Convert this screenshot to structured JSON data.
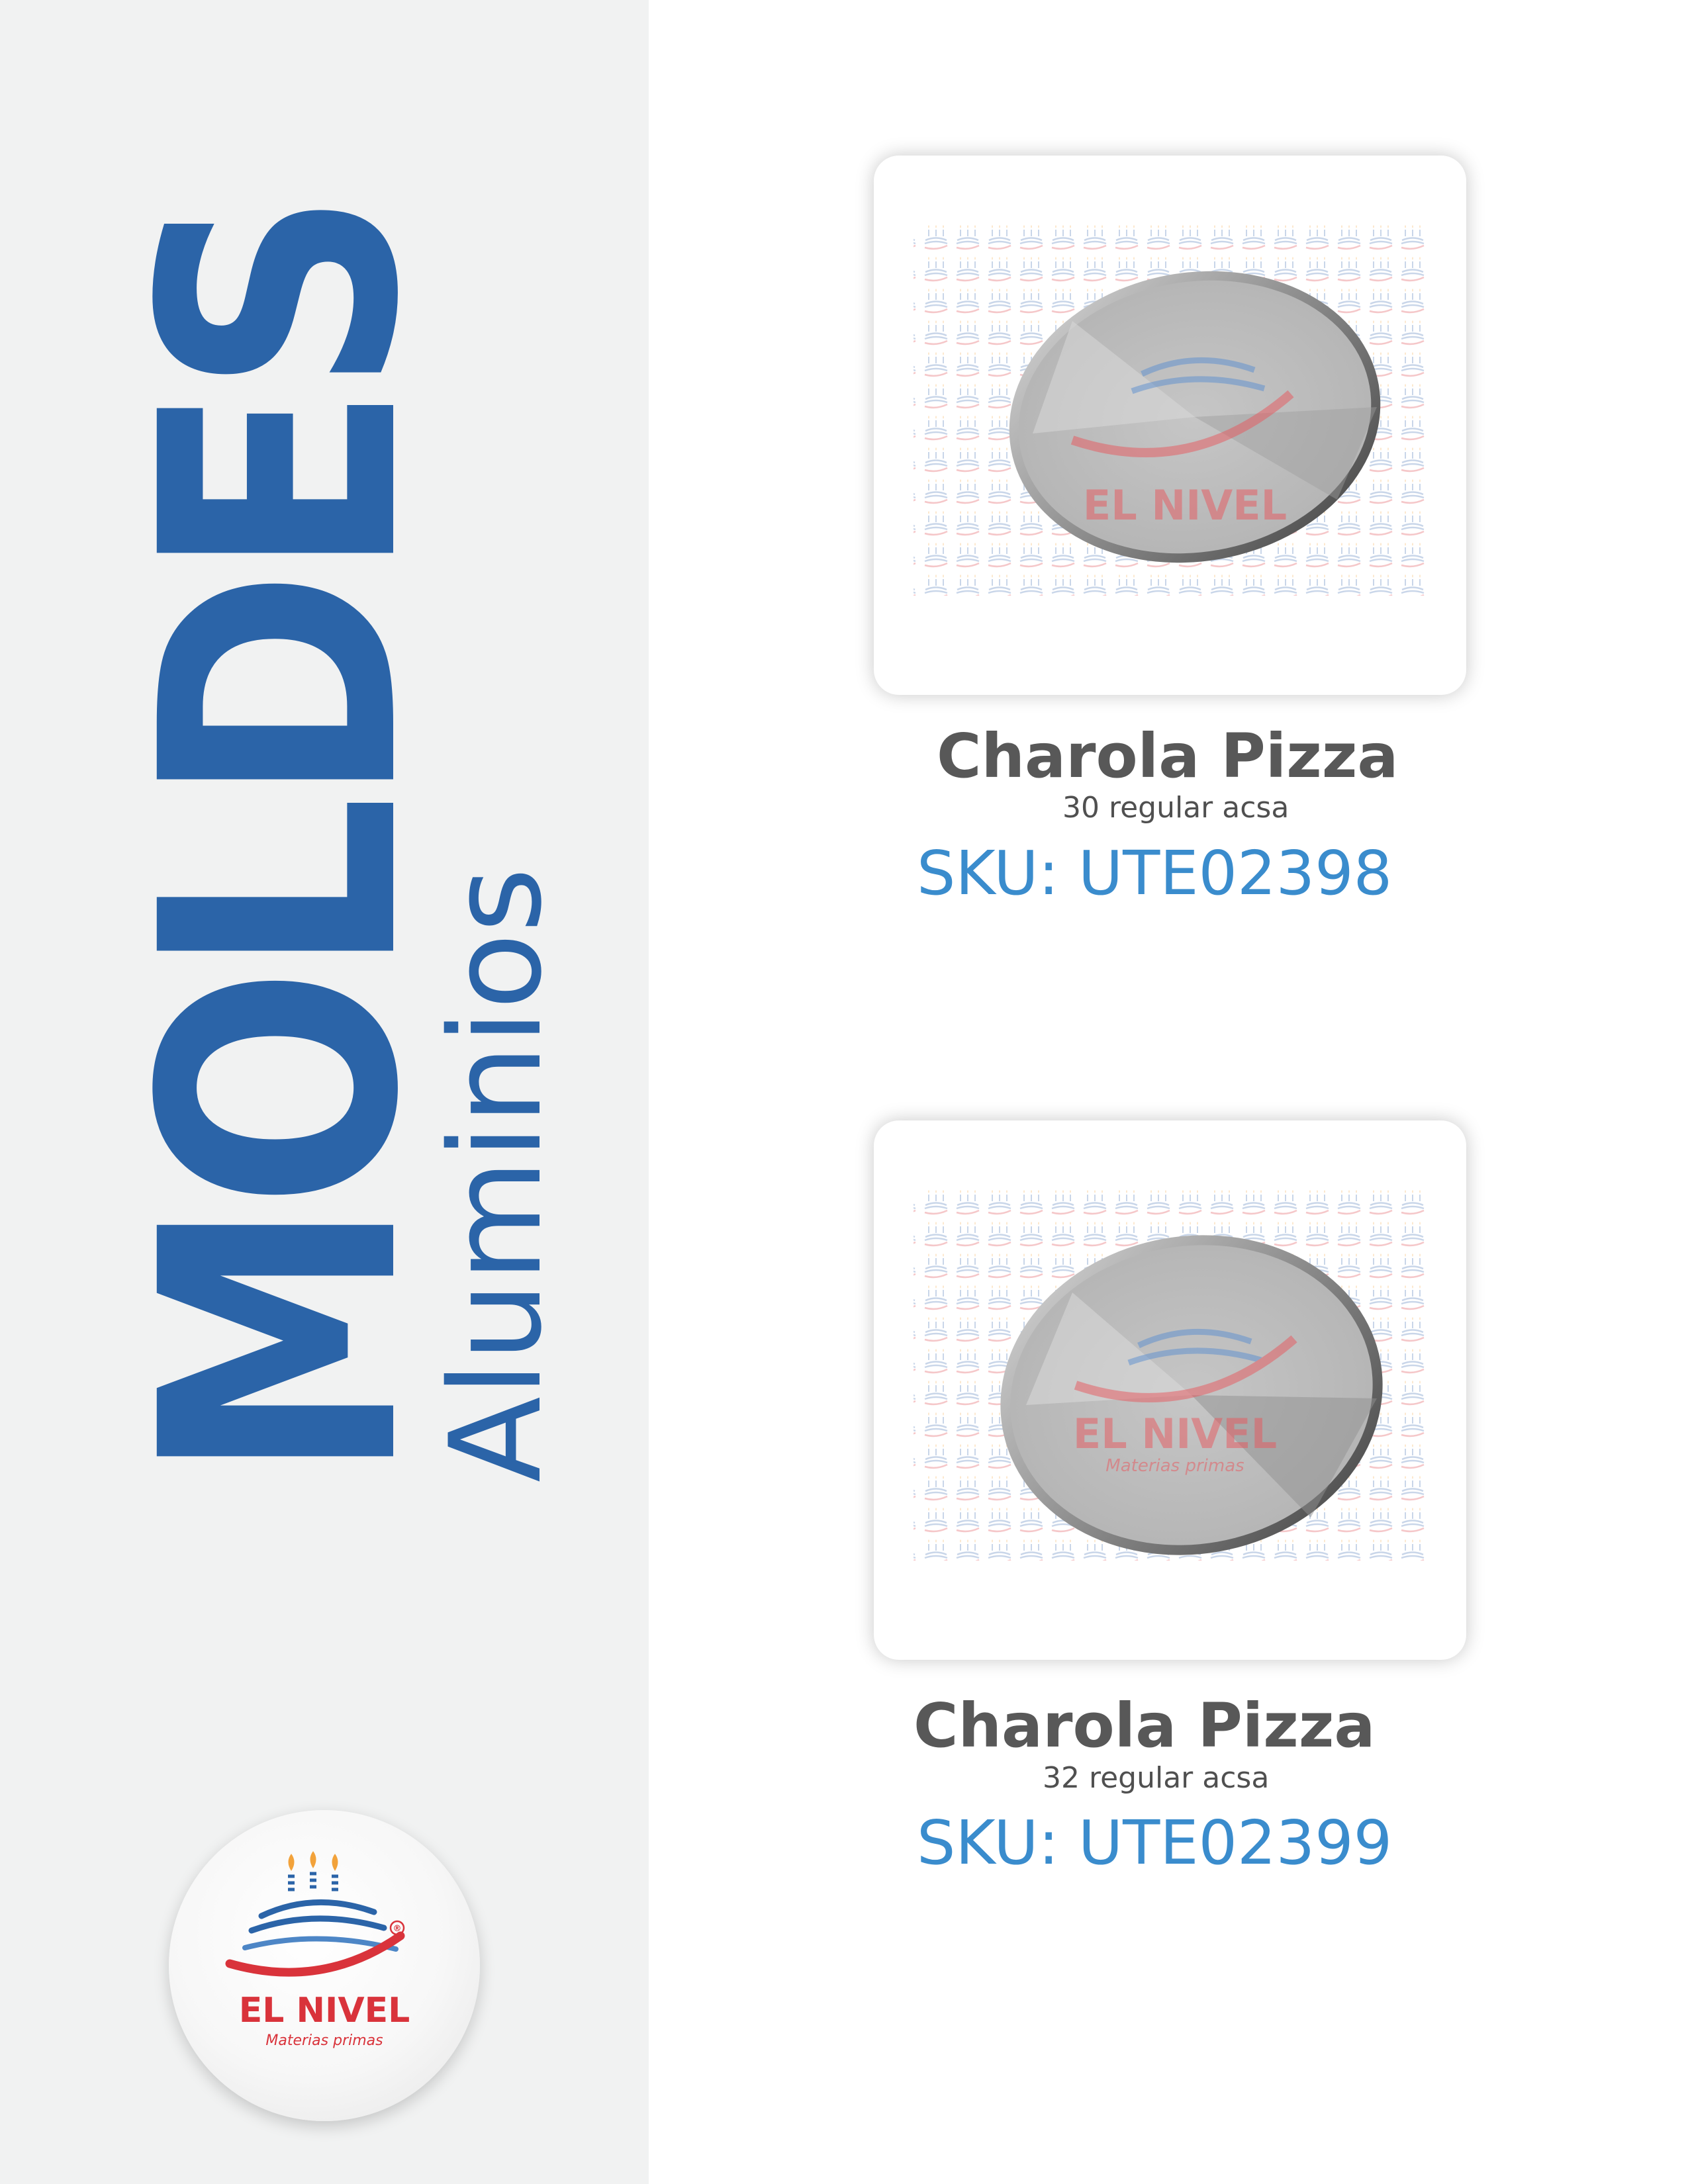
{
  "sidebar": {
    "title": "MOLDES",
    "subtitle": "Aluminios"
  },
  "brand": {
    "name": "EL NIVEL",
    "tagline": "Materias primas",
    "mark": "®"
  },
  "products": [
    {
      "name": "Charola Pizza",
      "description": "30 regular acsa",
      "sku": "SKU: UTE02398"
    },
    {
      "name": "Charola Pizza",
      "description": "32 regular acsa",
      "sku": "SKU: UTE02399"
    }
  ],
  "colors": {
    "sidebar_background": "#f1f2f2",
    "title_blue": "#2b64a8",
    "sku_blue": "#3a8ccd",
    "name_gray": "#585858",
    "brand_red": "#d9333b"
  }
}
